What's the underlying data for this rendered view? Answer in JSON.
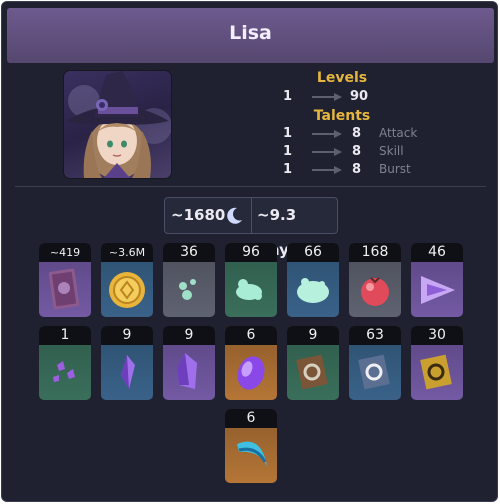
{
  "character": {
    "name": "Lisa"
  },
  "levels": {
    "heading": "Levels",
    "from": "1",
    "to": "90"
  },
  "talents": {
    "heading": "Talents",
    "rows": [
      {
        "from": "1",
        "to": "8",
        "label": "Attack"
      },
      {
        "from": "1",
        "to": "8",
        "label": "Skill"
      },
      {
        "from": "1",
        "to": "8",
        "label": "Burst"
      }
    ]
  },
  "summary": {
    "resin": "~1680",
    "resin_icon": "crescent-moon-icon",
    "days": "~9.3 Days"
  },
  "materials": [
    {
      "count": "~419",
      "icon": "exp-book-icon"
    },
    {
      "count": "~3.6M",
      "icon": "mora-coin-icon"
    },
    {
      "count": "36",
      "icon": "slime-condensate-icon"
    },
    {
      "count": "96",
      "icon": "slime-secretions-icon"
    },
    {
      "count": "66",
      "icon": "slime-concentrate-icon"
    },
    {
      "count": "168",
      "icon": "valberry-icon"
    },
    {
      "count": "46",
      "icon": "lightning-prism-icon"
    },
    {
      "count": "1",
      "icon": "vajrada-amethyst-sliver-icon"
    },
    {
      "count": "9",
      "icon": "vajrada-amethyst-fragment-icon"
    },
    {
      "count": "9",
      "icon": "vajrada-amethyst-chunk-icon"
    },
    {
      "count": "6",
      "icon": "vajrada-amethyst-gemstone-icon"
    },
    {
      "count": "9",
      "icon": "teachings-of-ballad-icon"
    },
    {
      "count": "63",
      "icon": "guide-to-ballad-icon"
    },
    {
      "count": "30",
      "icon": "philosophies-of-ballad-icon"
    },
    {
      "count": "6",
      "icon": "dvalins-claw-icon"
    }
  ],
  "colors": {
    "header": "#5f4f7d",
    "accent_gold": "#e5b73e",
    "panel": "#1f2130"
  }
}
